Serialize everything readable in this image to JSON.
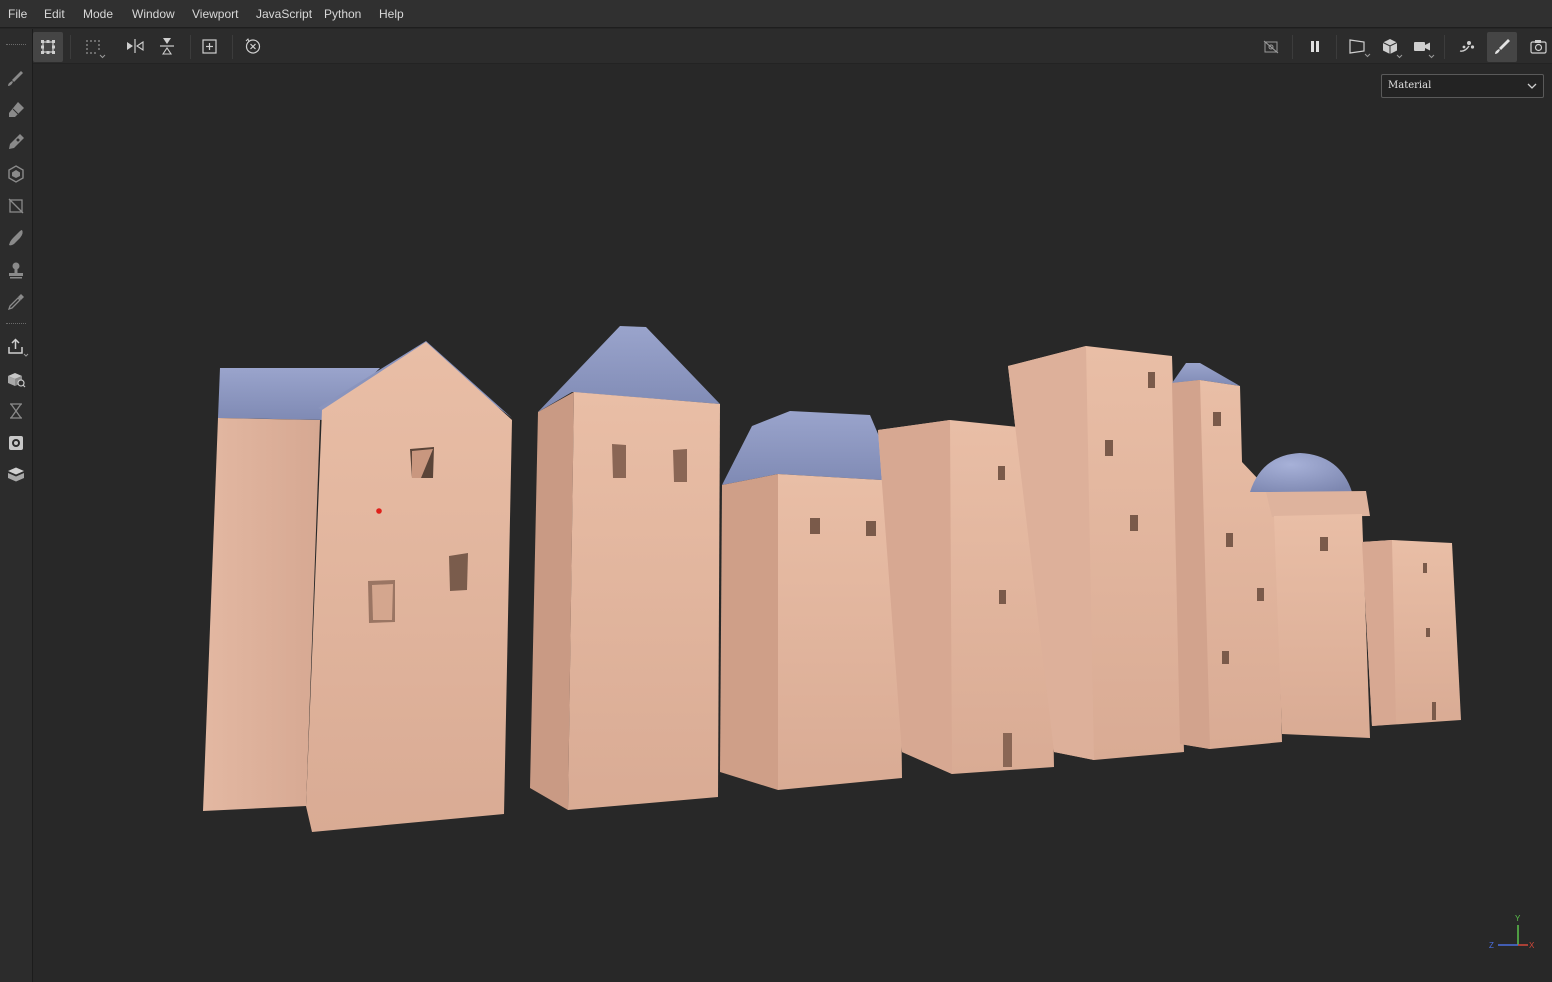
{
  "menu": {
    "items": [
      "File",
      "Edit",
      "Mode",
      "Window",
      "Viewport",
      "JavaScript",
      "Python",
      "Help"
    ]
  },
  "toolbar_left": {
    "icons": [
      "selection-mode-icon",
      "grid-select-icon",
      "mirror-horizontal-icon",
      "mirror-vertical-icon",
      "add-frame-icon",
      "reset-transform-icon"
    ]
  },
  "toolbar_right": {
    "icons": [
      "hide-overlay-icon",
      "pause-icon",
      "camera-perspective-icon",
      "render-mode-icon",
      "video-camera-icon",
      "bake-icon",
      "paint-brush-icon",
      "screenshot-icon"
    ]
  },
  "sidebar": {
    "tools": [
      "paint-tool-icon",
      "eraser-tool-icon",
      "projection-tool-icon",
      "polygon-fill-icon",
      "geometry-mask-icon",
      "smudge-tool-icon",
      "clone-stamp-icon",
      "color-picker-icon",
      "export-icon",
      "asset-library-icon",
      "history-icon",
      "display-settings-icon",
      "texture-set-icon"
    ]
  },
  "viewport": {
    "material_dropdown": {
      "value": "Material"
    },
    "axis_gizmo": {
      "y": "Y",
      "z": "Z",
      "x": "X"
    }
  },
  "colors": {
    "wall": "#e0b49c",
    "roof": "#8f99c2",
    "background": "#282828",
    "axis_x": "#d2483a",
    "axis_y": "#5cc24c",
    "axis_z": "#4a6fe0"
  }
}
